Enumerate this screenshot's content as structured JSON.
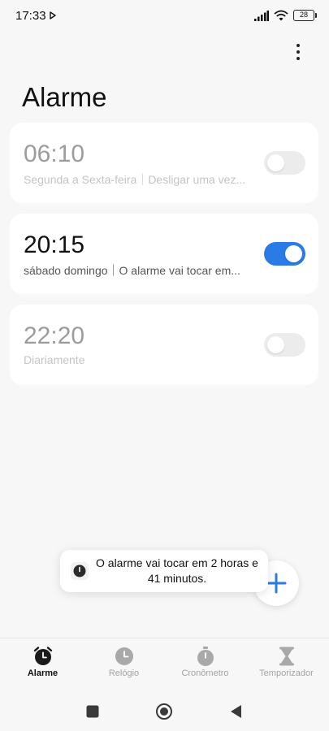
{
  "status_bar": {
    "time": "17:33",
    "battery": "28"
  },
  "header": {
    "title": "Alarme"
  },
  "alarms": [
    {
      "time": "06:10",
      "subtitle": "Segunda a Sexta-feira｜Desligar uma vez...",
      "enabled": false
    },
    {
      "time": "20:15",
      "subtitle": "sábado domingo｜O alarme vai tocar em...",
      "enabled": true
    },
    {
      "time": "22:20",
      "subtitle": "Diariamente",
      "enabled": false
    }
  ],
  "toast": {
    "text": "O alarme vai tocar em 2 horas e 41 minutos."
  },
  "bottom_nav": {
    "items": [
      {
        "label": "Alarme",
        "icon": "alarm-clock-icon",
        "active": true
      },
      {
        "label": "Relógio",
        "icon": "clock-icon",
        "active": false
      },
      {
        "label": "Cronômetro",
        "icon": "stopwatch-icon",
        "active": false
      },
      {
        "label": "Temporizador",
        "icon": "hourglass-icon",
        "active": false
      }
    ]
  },
  "colors": {
    "accent": "#2b7be6",
    "background": "#f7f7f7",
    "card": "#ffffff",
    "inactive_text": "#9c9c9c"
  }
}
